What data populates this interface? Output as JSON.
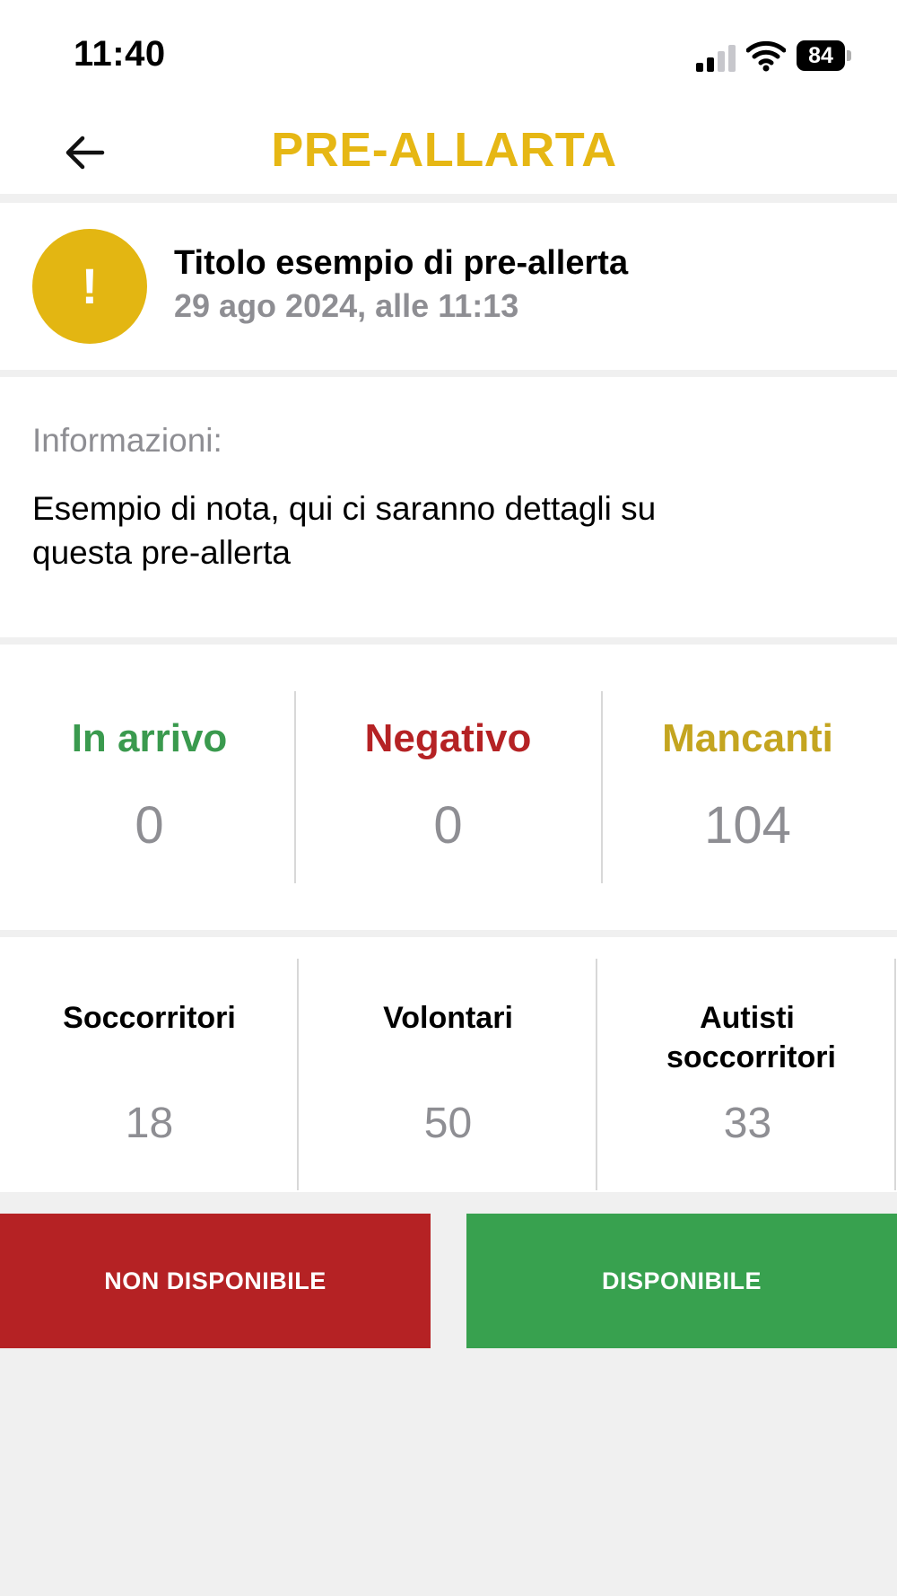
{
  "status_bar": {
    "time": "11:40",
    "battery": "84"
  },
  "header": {
    "title": "PRE-ALLARTA"
  },
  "alert": {
    "icon_symbol": "!",
    "title": "Titolo esempio di pre-allerta",
    "date": "29 ago 2024, alle 11:13"
  },
  "info": {
    "label": "Informazioni:",
    "text": "Esempio di nota, qui ci saranno dettagli su questa pre-allerta"
  },
  "stats": [
    {
      "label": "In arrivo",
      "value": "0",
      "color": "#3a9a4e"
    },
    {
      "label": "Negativo",
      "value": "0",
      "color": "#b52224"
    },
    {
      "label": "Mancanti",
      "value": "104",
      "color": "#c4a520"
    }
  ],
  "roles": [
    {
      "label": "Soccorritori",
      "value": "18"
    },
    {
      "label": "Volontari",
      "value": "50"
    },
    {
      "label": "Autisti soccorritori",
      "value": "33"
    }
  ],
  "buttons": {
    "unavailable": "NON DISPONIBILE",
    "available": "DISPONIBILE"
  },
  "colors": {
    "accent": "#e6b714",
    "unavailable": "#b52224",
    "available": "#38a14f"
  }
}
